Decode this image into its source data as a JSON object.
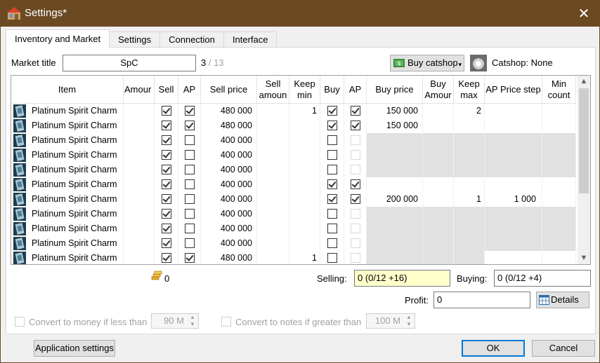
{
  "window": {
    "title": "Settings*",
    "close_glyph": "✕"
  },
  "tabs": [
    {
      "label": "Inventory and Market",
      "active": true
    },
    {
      "label": "Settings"
    },
    {
      "label": "Connection"
    },
    {
      "label": "Interface"
    }
  ],
  "market": {
    "title_label": "Market title",
    "title_value": "SpC",
    "count_current": "3",
    "count_sep": " / 13",
    "buy_catshop_label": "Buy catshop",
    "catshop_status": "Catshop: None"
  },
  "grid": {
    "headers": [
      "Item",
      "Amour",
      "Sell",
      "AP",
      "Sell price",
      "Sell amoun",
      "Keep min",
      "Buy",
      "AP",
      "Buy price",
      "Buy Amour",
      "Keep max",
      "AP Price step",
      "Min count"
    ],
    "rows": [
      {
        "name": "Platinum Spirit Charm",
        "sell": true,
        "sap": true,
        "sell_price": "480 000",
        "keep_min": "1",
        "buy": true,
        "bap": true,
        "bap_enabled": true,
        "buy_price": "150 000",
        "keep_max": "2",
        "ap_step": "",
        "gray": false
      },
      {
        "name": "Platinum Spirit Charm",
        "sell": true,
        "sap": true,
        "sell_price": "480 000",
        "keep_min": "",
        "buy": true,
        "bap": true,
        "bap_enabled": true,
        "buy_price": "150 000",
        "keep_max": "",
        "ap_step": "",
        "gray": false
      },
      {
        "name": "Platinum Spirit Charm",
        "sell": true,
        "sap": false,
        "sell_price": "400 000",
        "keep_min": "",
        "buy": false,
        "bap": false,
        "bap_enabled": false,
        "buy_price": "",
        "keep_max": "",
        "ap_step": "",
        "gray": true
      },
      {
        "name": "Platinum Spirit Charm",
        "sell": true,
        "sap": false,
        "sell_price": "400 000",
        "keep_min": "",
        "buy": false,
        "bap": false,
        "bap_enabled": false,
        "buy_price": "",
        "keep_max": "",
        "ap_step": "",
        "gray": true
      },
      {
        "name": "Platinum Spirit Charm",
        "sell": true,
        "sap": false,
        "sell_price": "400 000",
        "keep_min": "",
        "buy": false,
        "bap": false,
        "bap_enabled": false,
        "buy_price": "",
        "keep_max": "",
        "ap_step": "",
        "gray": true
      },
      {
        "name": "Platinum Spirit Charm",
        "sell": true,
        "sap": false,
        "sell_price": "400 000",
        "keep_min": "",
        "buy": true,
        "bap": true,
        "bap_enabled": true,
        "buy_price": "",
        "keep_max": "",
        "ap_step": "",
        "gray": false
      },
      {
        "name": "Platinum Spirit Charm",
        "sell": true,
        "sap": false,
        "sell_price": "400 000",
        "keep_min": "",
        "buy": true,
        "bap": true,
        "bap_enabled": true,
        "buy_price": "200 000",
        "keep_max": "1",
        "ap_step": "1 000",
        "gray": false
      },
      {
        "name": "Platinum Spirit Charm",
        "sell": true,
        "sap": false,
        "sell_price": "400 000",
        "keep_min": "",
        "buy": false,
        "bap": false,
        "bap_enabled": false,
        "buy_price": "",
        "keep_max": "",
        "ap_step": "",
        "gray": true
      },
      {
        "name": "Platinum Spirit Charm",
        "sell": true,
        "sap": false,
        "sell_price": "400 000",
        "keep_min": "",
        "buy": false,
        "bap": false,
        "bap_enabled": false,
        "buy_price": "",
        "keep_max": "",
        "ap_step": "",
        "gray": true
      },
      {
        "name": "Platinum Spirit Charm",
        "sell": true,
        "sap": false,
        "sell_price": "400 000",
        "keep_min": "",
        "buy": false,
        "bap": false,
        "bap_enabled": false,
        "buy_price": "",
        "keep_max": "",
        "ap_step": "",
        "gray": true
      },
      {
        "name": "Platinum Spirit Charm",
        "sell": true,
        "sap": true,
        "sell_price": "480 000",
        "keep_min": "1",
        "buy": false,
        "bap": false,
        "bap_enabled": false,
        "buy_price": "",
        "keep_max": "",
        "ap_step": "",
        "gray": true
      }
    ]
  },
  "summary": {
    "money_value": "0",
    "selling_label": "Selling:",
    "selling_value": "0 (0/12 +16)",
    "buying_label": "Buying:",
    "buying_value": "0 (0/12 +4)",
    "profit_label": "Profit:",
    "profit_value": "0",
    "details_label": "Details"
  },
  "convert": {
    "money_label": "Convert to money if less than",
    "money_value": "90 M",
    "notes_label": "Convert to notes if greater than",
    "notes_value": "100 M"
  },
  "footer": {
    "app_settings_label": "Application settings",
    "ok_label": "OK",
    "cancel_label": "Cancel"
  },
  "colors": {
    "titlebar": "#6b4a22",
    "selling_bg": "#ffffcc",
    "gray_block": "#e1e1e1",
    "default_button_border": "#0078d7"
  }
}
